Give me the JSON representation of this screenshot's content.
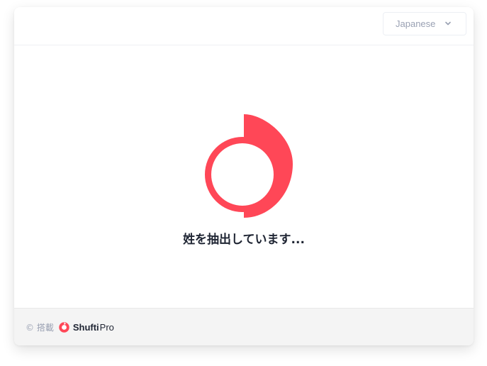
{
  "header": {
    "language_select": {
      "value": "Japanese",
      "icon": "chevron-down-icon"
    }
  },
  "main": {
    "loader_icon": "spinner-icon",
    "status_text": "姓を抽出しています..."
  },
  "footer": {
    "powered_by": "© 搭載",
    "brand_logo_icon": "shufti-logo-icon",
    "brand_name_strong": "Shufti",
    "brand_name_light": "Pro"
  },
  "colors": {
    "accent": "#ff4757",
    "text_dark": "#1f2533",
    "text_muted": "#9aa1b3",
    "footer_bg": "#f4f4f4"
  }
}
